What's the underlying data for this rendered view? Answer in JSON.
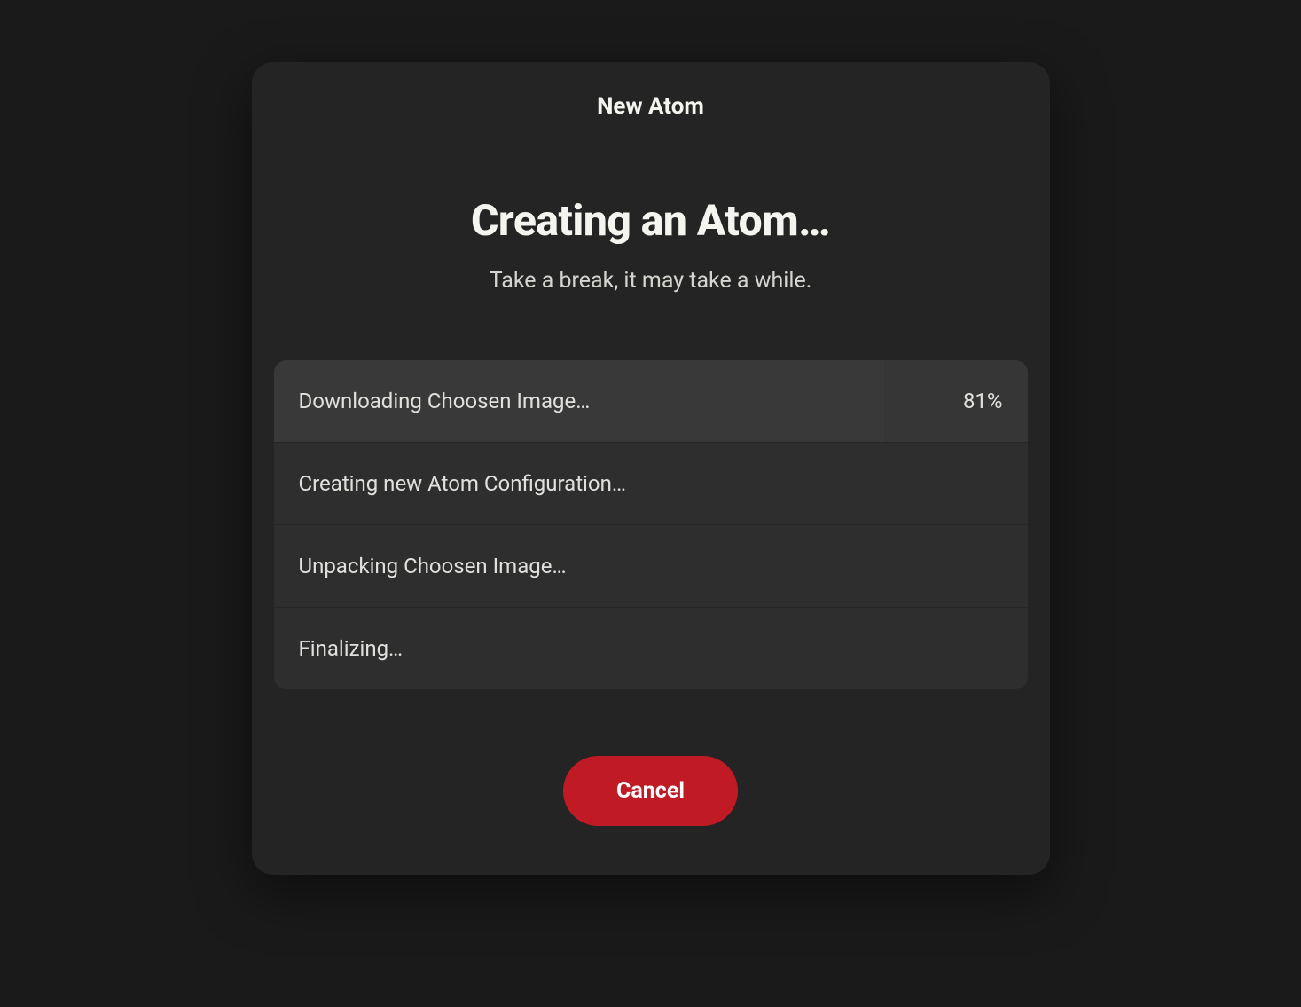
{
  "dialog": {
    "title": "New Atom",
    "heading": "Creating an Atom…",
    "subtitle": "Take a break, it may take a while."
  },
  "steps": [
    {
      "label": "Downloading Choosen Image…",
      "percent": "81%",
      "active": true
    },
    {
      "label": "Creating new Atom Configuration…",
      "percent": "",
      "active": false
    },
    {
      "label": "Unpacking Choosen Image…",
      "percent": "",
      "active": false
    },
    {
      "label": "Finalizing…",
      "percent": "",
      "active": false
    }
  ],
  "actions": {
    "cancel_label": "Cancel"
  },
  "colors": {
    "background": "#1a1a1a",
    "dialog_bg": "#242424",
    "step_bg": "#2e2e2e",
    "step_active_bg": "#363636",
    "text_primary": "#f5f5f0",
    "text_secondary": "#d5d5d0",
    "cancel_button": "#c01b24"
  }
}
